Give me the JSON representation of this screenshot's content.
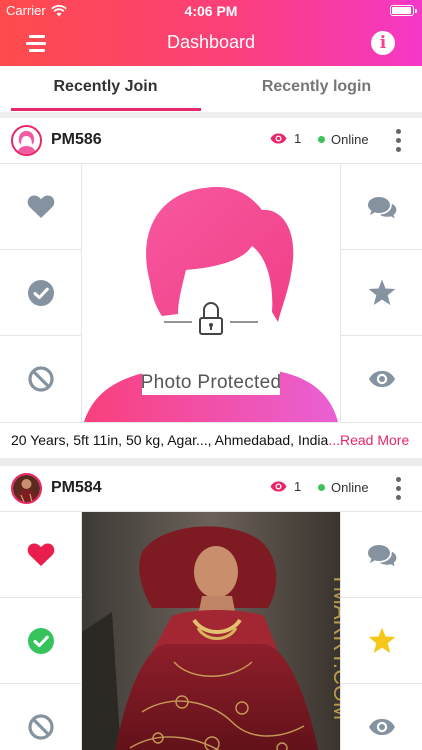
{
  "status_bar": {
    "carrier": "Carrier",
    "time": "4:06 PM"
  },
  "nav": {
    "title": "Dashboard",
    "menu_icon": "hamburger-menu-icon",
    "info_icon": "info-icon",
    "info_glyph": "i"
  },
  "tabs": [
    {
      "label": "Recently Join",
      "active": true
    },
    {
      "label": "Recently login",
      "active": false
    }
  ],
  "profiles": [
    {
      "username": "PM586",
      "views": "1",
      "status": "Online",
      "photo_state": "Photo Protected",
      "details": "20 Years, 5ft 11in, 50 kg, Agar..., Ahmedabad, India",
      "read_more": "...Read More",
      "liked": false,
      "accepted": false,
      "starred": false
    },
    {
      "username": "PM584",
      "views": "1",
      "status": "Online",
      "photo_watermark": "YMARRY.COM",
      "liked": true,
      "accepted": true,
      "starred": true
    }
  ],
  "colors": {
    "accent": "#e92766",
    "gradient_start": "#ff4b4b",
    "gradient_end": "#f538c8",
    "online": "#3cc45a",
    "icon_inactive": "#8592a0",
    "liked": "#e91e4e",
    "accepted": "#36c35c",
    "starred": "#f6c619"
  }
}
